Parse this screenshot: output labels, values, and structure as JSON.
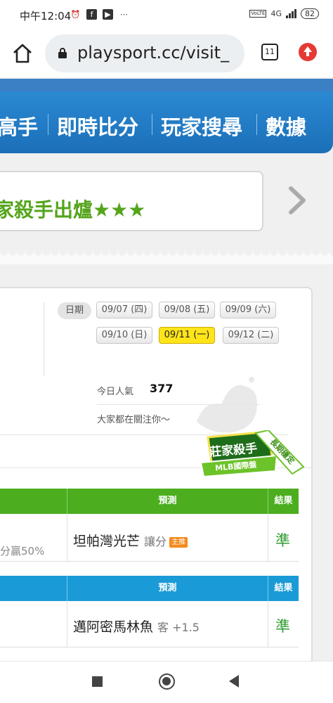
{
  "status_bar": {
    "time": "中午12:04",
    "network": "4G",
    "battery": "82"
  },
  "browser": {
    "url": "playsport.cc/visit_",
    "tab_count": "11"
  },
  "nav": {
    "items": [
      "高手",
      "即時比分",
      "玩家搜尋",
      "數據"
    ]
  },
  "ticker": {
    "text": "家殺手出爐★★★"
  },
  "dates": {
    "label": "日期",
    "items": [
      "09/07 (四)",
      "09/08 (五)",
      "09/09 (六)",
      "09/10 (日)",
      "09/11 (一)",
      "09/12 (二)"
    ],
    "active": "09/11 (一)"
  },
  "stats": {
    "popularity_label": "今日人氣",
    "popularity_value": "377",
    "follow_text": "大家都在關注你～"
  },
  "badge": {
    "title": "莊家殺手",
    "subtitle": "MLB國際盤",
    "ribbon": "長期穩定"
  },
  "table1": {
    "header_color": "#4cae1f",
    "col_predict": "預測",
    "col_result": "結果",
    "winrate": "分贏50%",
    "team": "坦帕灣光芒",
    "bet": "讓分",
    "tag": "主推",
    "result": "準"
  },
  "table2": {
    "header_color": "#1a9ad6",
    "col_predict": "預測",
    "col_result": "結果",
    "team": "邁阿密馬林魚",
    "bet": "客 +1.5",
    "result": "準"
  }
}
